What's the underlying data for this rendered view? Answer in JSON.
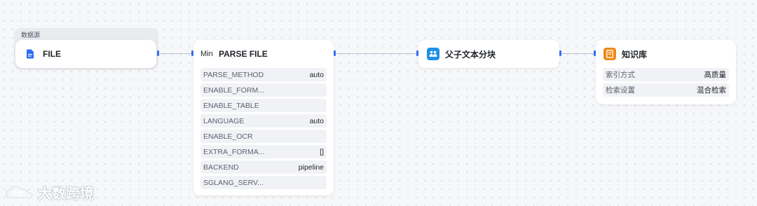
{
  "group": {
    "label": "数据源"
  },
  "nodes": {
    "file": {
      "title": "FILE",
      "icon": "file-icon"
    },
    "parse_file": {
      "prefix": "Min",
      "title": "PARSE FILE",
      "params": [
        {
          "key": "PARSE_METHOD",
          "value": "auto"
        },
        {
          "key": "ENABLE_FORM...",
          "value": ""
        },
        {
          "key": "ENABLE_TABLE",
          "value": ""
        },
        {
          "key": "LANGUAGE",
          "value": "auto"
        },
        {
          "key": "ENABLE_OCR",
          "value": ""
        },
        {
          "key": "EXTRA_FORMA...",
          "value": "[]"
        },
        {
          "key": "BACKEND",
          "value": "pipeline"
        },
        {
          "key": "SGLANG_SERV...",
          "value": ""
        }
      ]
    },
    "chunk": {
      "title": "父子文本分块",
      "icon": "people-icon",
      "icon_color": "#1e90e6"
    },
    "kb": {
      "title": "知识库",
      "icon": "book-icon",
      "icon_color": "#f08a18",
      "params": [
        {
          "key": "索引方式",
          "value": "高质量"
        },
        {
          "key": "检索设置",
          "value": "混合检索"
        }
      ]
    }
  },
  "watermark": {
    "text": "大数跨境",
    "logo": "cloud-logo"
  },
  "colors": {
    "port": "#3b6ff5",
    "edge": "#b9c4d6",
    "canvas": "#f6f7f9"
  }
}
